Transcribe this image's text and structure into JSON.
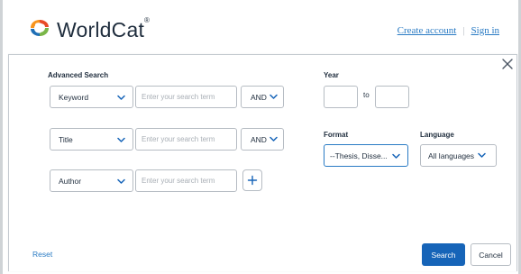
{
  "header": {
    "logo_text": "WorldCat",
    "logo_mark": "®",
    "create_account": "Create account",
    "separator": "|",
    "sign_in": "Sign in"
  },
  "dialog": {
    "title": "Advanced Search",
    "close_icon": "close-icon",
    "rows": [
      {
        "field": "Keyword",
        "placeholder": "Enter your search term",
        "operator": "AND"
      },
      {
        "field": "Title",
        "placeholder": "Enter your search term",
        "operator": "AND"
      },
      {
        "field": "Author",
        "placeholder": "Enter your search term",
        "operator": ""
      }
    ],
    "year_label": "Year",
    "year_to": "to",
    "format_label": "Format",
    "format_value": "--Thesis, Disse...",
    "language_label": "Language",
    "language_value": "All languages",
    "reset": "Reset",
    "search": "Search",
    "cancel": "Cancel"
  },
  "colors": {
    "accent": "#1664b8",
    "link": "#2a7bc4",
    "text": "#1f2d3d",
    "border": "#b6bcc3",
    "placeholder": "#a8aeb5"
  }
}
